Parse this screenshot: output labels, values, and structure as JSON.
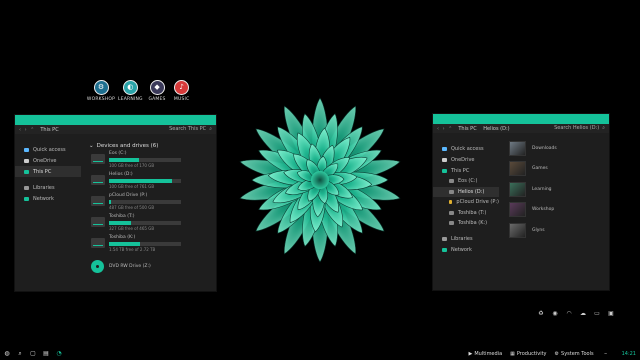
{
  "dock": [
    {
      "label": "WORKSHOP",
      "icon": "workshop-icon",
      "color": "#1e6f8f"
    },
    {
      "label": "LEARNING",
      "icon": "learning-icon",
      "color": "#2aa3a8"
    },
    {
      "label": "GAMES",
      "icon": "games-icon",
      "color": "#3b3a5a"
    },
    {
      "label": "MUSIC",
      "icon": "music-icon",
      "color": "#d63a3a"
    }
  ],
  "left_window": {
    "address": "This PC",
    "search_placeholder": "Search This PC",
    "sidebar": [
      {
        "label": "Quick access",
        "icon": "star-icon",
        "color": "#5bb8ff"
      },
      {
        "label": "OneDrive",
        "icon": "cloud-icon",
        "color": "#cccccc"
      },
      {
        "label": "This PC",
        "icon": "computer-icon",
        "color": "#15c29a",
        "selected": true
      },
      {
        "label": "Libraries",
        "icon": "library-icon",
        "color": "#999999"
      },
      {
        "label": "Network",
        "icon": "network-icon",
        "color": "#15c29a"
      }
    ],
    "section_title": "Devices and drives (6)",
    "drives": [
      {
        "name": "Eos (C:)",
        "free": "100 GB free of 170 GB",
        "used_fraction": 0.41
      },
      {
        "name": "Helios (D:)",
        "free": "100 GB free of 761 GB",
        "used_fraction": 0.87
      },
      {
        "name": "pCloud Drive (P:)",
        "free": "487 GB free of 500 GB",
        "used_fraction": 0.03
      },
      {
        "name": "Toshiba (T:)",
        "free": "327 GB free of 465 GB",
        "used_fraction": 0.3
      },
      {
        "name": "Toshiba (K:)",
        "free": "1.54 TB free of 2.72 TB",
        "used_fraction": 0.43
      }
    ],
    "dvd": "DVD RW Drive (Z:)"
  },
  "right_window": {
    "address_parts": [
      "This PC",
      "Helios (D:)"
    ],
    "search_placeholder": "Search Helios (D:)",
    "sidebar": [
      {
        "label": "Quick access",
        "icon": "star-icon",
        "color": "#5bb8ff",
        "sub": false
      },
      {
        "label": "OneDrive",
        "icon": "cloud-icon",
        "color": "#cccccc",
        "sub": false
      },
      {
        "label": "This PC",
        "icon": "computer-icon",
        "color": "#15c29a",
        "sub": false
      },
      {
        "label": "Eos (C:)",
        "icon": "drive-icon",
        "color": "#888888",
        "sub": true
      },
      {
        "label": "Helios (D:)",
        "icon": "drive-icon",
        "color": "#888888",
        "sub": true,
        "selected": true
      },
      {
        "label": "pCloud Drive (P:)",
        "icon": "drive-icon",
        "color": "#e0b030",
        "sub": true
      },
      {
        "label": "Toshiba (T:)",
        "icon": "drive-icon",
        "color": "#888888",
        "sub": true
      },
      {
        "label": "Toshiba (K:)",
        "icon": "drive-icon",
        "color": "#888888",
        "sub": true
      },
      {
        "label": "Libraries",
        "icon": "library-icon",
        "color": "#999999",
        "sub": false
      },
      {
        "label": "Network",
        "icon": "network-icon",
        "color": "#15c29a",
        "sub": false
      }
    ],
    "folders": [
      {
        "name": "Downloads",
        "thumb": "#6f7a84"
      },
      {
        "name": "Games",
        "thumb": "#5a4a3a"
      },
      {
        "name": "Learning",
        "thumb": "#3a6f5a"
      },
      {
        "name": "Workshop",
        "thumb": "#5a3a5a"
      },
      {
        "name": "Glyns",
        "thumb": "#6a6a6a"
      }
    ]
  },
  "tray_icons": [
    "recycle-icon",
    "chat-icon",
    "wifi-icon",
    "cloud-icon",
    "folder-icon",
    "display-icon"
  ],
  "taskbar": {
    "left_icons": [
      "start-icon",
      "search-icon",
      "task-view-icon",
      "store-icon",
      "browser-icon"
    ],
    "groups": [
      {
        "label": "Multimedia",
        "icon": "play-icon"
      },
      {
        "label": "Productivity",
        "icon": "briefcase-icon"
      },
      {
        "label": "System Tools",
        "icon": "gear-icon"
      }
    ],
    "clock": "14:21"
  },
  "colors": {
    "accent": "#15c29a",
    "window_bg": "#1e1e1e"
  }
}
